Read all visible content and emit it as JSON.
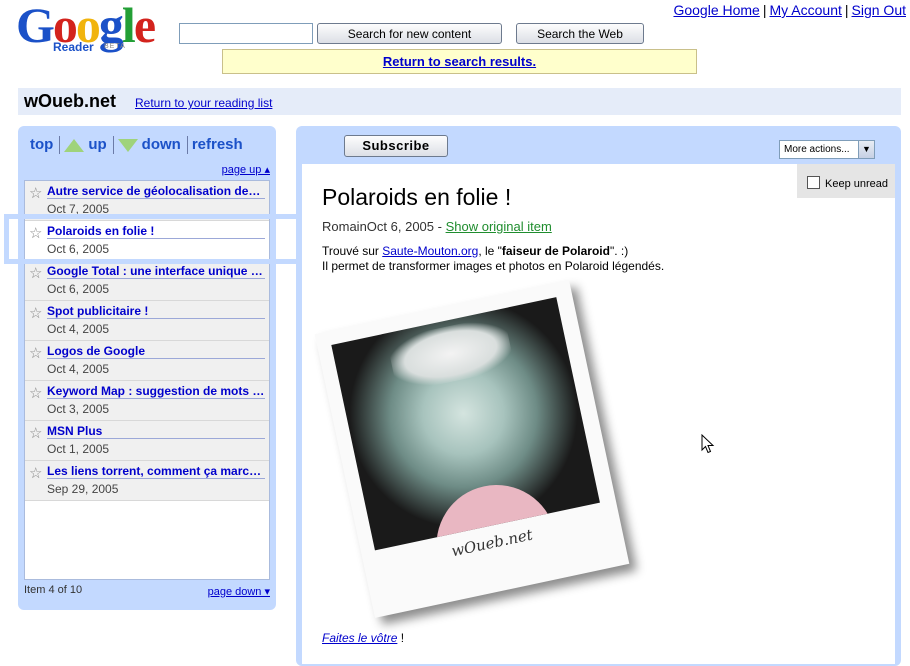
{
  "logo": {
    "letters": [
      "G",
      "o",
      "o",
      "g",
      "l",
      "e"
    ],
    "sub": "Reader",
    "beta": "BETA"
  },
  "search": {
    "value": "",
    "new_content_label": "Search for new content",
    "web_label": "Search the Web"
  },
  "top_links": [
    "Google Home",
    "My Account",
    "Sign Out"
  ],
  "return_results": "Return to search results.",
  "feed": {
    "title": "wOueb.net",
    "return_list": "Return to your reading list"
  },
  "nav": {
    "top": "top",
    "up": "up",
    "down": "down",
    "refresh": "refresh",
    "page_up": "page up ▴",
    "page_down": "page down ▾",
    "count": "Item 4 of 10"
  },
  "items": [
    {
      "title": "Autre service de géolocalisation des…",
      "date": "Oct 7, 2005"
    },
    {
      "title": "Polaroids en folie !",
      "date": "Oct 6, 2005"
    },
    {
      "title": "Google Total : une interface unique b…",
      "date": "Oct 6, 2005"
    },
    {
      "title": "Spot publicitaire !",
      "date": "Oct 4, 2005"
    },
    {
      "title": "Logos de Google",
      "date": "Oct 4, 2005"
    },
    {
      "title": "Keyword Map : suggestion de mots …",
      "date": "Oct 3, 2005"
    },
    {
      "title": "MSN Plus",
      "date": "Oct 1, 2005"
    },
    {
      "title": "Les liens torrent, comment ça marc…",
      "date": "Sep 29, 2005"
    }
  ],
  "entry": {
    "subscribe": "Subscribe",
    "more_actions": "More actions...",
    "keep_unread": "Keep unread",
    "title": "Polaroids en folie !",
    "meta": "RomainOct 6, 2005 -",
    "show_original": "Show original item",
    "body_prefix": "Trouvé sur ",
    "body_link": "Saute-Mouton.org",
    "body_mid": ", le \"",
    "body_bold": "faiseur de Polaroid",
    "body_suffix": "\". :)",
    "body_line2": "Il permet de transformer images et photos en Polaroid légendés.",
    "polaroid_caption": "wOueb.net",
    "faites_link": "Faites le vôtre",
    "faites_suffix": " !"
  },
  "icons": {
    "star": "☆",
    "dropdown": "▼"
  },
  "colors": {
    "panel_blue": "#c3d9ff",
    "title_bar": "#e5ecf9",
    "return_yellow": "#ffffcc",
    "link": "#0000cc",
    "original_link": "#1f8d2e",
    "arrow_green": "#9fd37b"
  }
}
